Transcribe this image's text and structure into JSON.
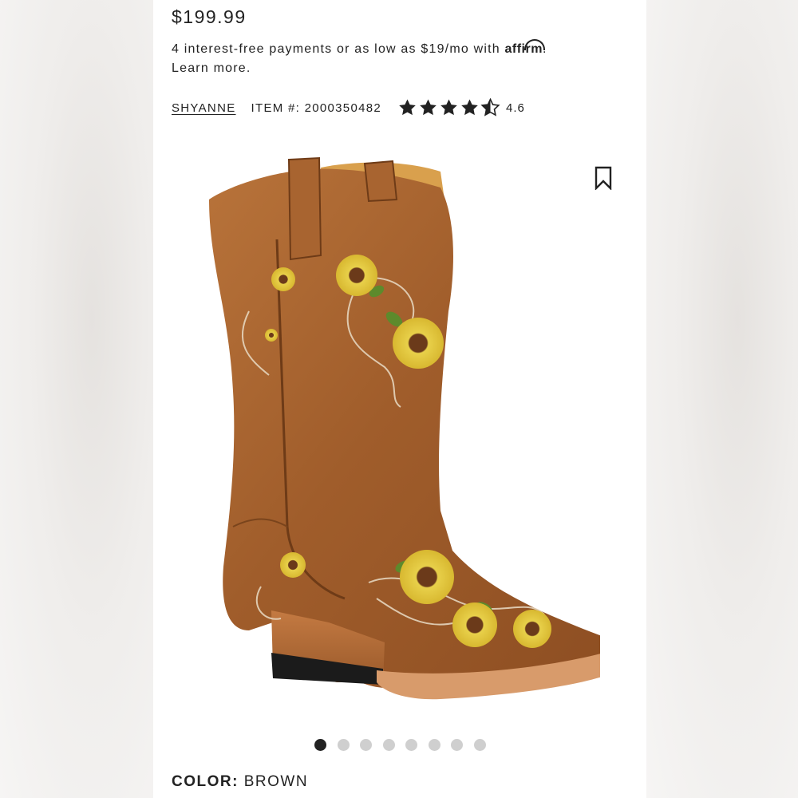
{
  "product": {
    "price": "$199.99",
    "payments_text": "4 interest-free payments or as low as $19/mo with ",
    "affirm_logo": "affirm",
    "payments_suffix": ".",
    "learn_more": "Learn more.",
    "brand": "SHYANNE",
    "item_label": "ITEM #: 2000350482",
    "rating": "4.6",
    "rating_value": 4.6,
    "color_label": "COLOR:",
    "color_value": "BROWN"
  },
  "icons": {
    "bookmark": "bookmark-icon",
    "star": "star-icon"
  },
  "carousel": {
    "total": 8,
    "active_index": 0
  },
  "colors": {
    "text": "#222222",
    "dot_inactive": "#cfcfcf",
    "boot_leather": "#a5622e"
  }
}
